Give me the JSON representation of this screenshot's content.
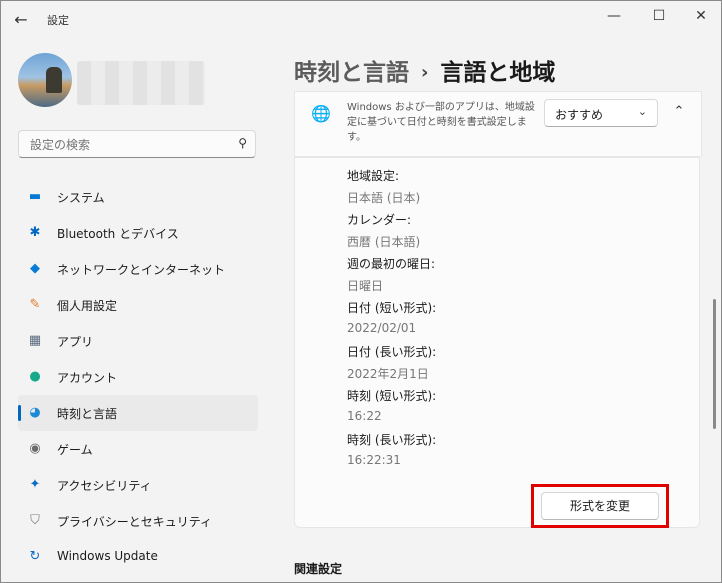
{
  "window": {
    "title": "設定"
  },
  "search": {
    "placeholder": "設定の検索"
  },
  "sidebar": {
    "items": [
      {
        "label": "システム",
        "icon": "monitor-icon",
        "color": "#0078d4"
      },
      {
        "label": "Bluetooth とデバイス",
        "icon": "bluetooth-icon",
        "color": "#0067c0"
      },
      {
        "label": "ネットワークとインターネット",
        "icon": "wifi-icon",
        "color": "#0a7bd6"
      },
      {
        "label": "個人用設定",
        "icon": "brush-icon",
        "color": "#e07b2c"
      },
      {
        "label": "アプリ",
        "icon": "apps-icon",
        "color": "#5a6b7d"
      },
      {
        "label": "アカウント",
        "icon": "person-icon",
        "color": "#18a88a"
      },
      {
        "label": "時刻と言語",
        "icon": "globe-clock-icon",
        "color": "#1d8ad8",
        "active": true
      },
      {
        "label": "ゲーム",
        "icon": "gamepad-icon",
        "color": "#6b6b6b"
      },
      {
        "label": "アクセシビリティ",
        "icon": "accessibility-icon",
        "color": "#0a6cc2"
      },
      {
        "label": "プライバシーとセキュリティ",
        "icon": "shield-icon",
        "color": "#7a7a7a"
      },
      {
        "label": "Windows Update",
        "icon": "update-icon",
        "color": "#0a6cc2"
      }
    ]
  },
  "breadcrumb": {
    "parent": "時刻と言語",
    "separator": "›",
    "current": "言語と地域"
  },
  "format_card": {
    "description": "Windows および一部のアプリは、地域設定に基づいて日付と時刻を書式設定します。",
    "dropdown_value": "おすすめ",
    "rows": [
      {
        "label": "地域設定:",
        "value": "日本語 (日本)"
      },
      {
        "label": "カレンダー:",
        "value": "西暦 (日本語)"
      },
      {
        "label": "週の最初の曜日:",
        "value": "日曜日"
      },
      {
        "label": "日付 (短い形式):",
        "value": "2022/02/01"
      },
      {
        "label": "日付 (長い形式):",
        "value": "2022年2月1日"
      },
      {
        "label": "時刻 (短い形式):",
        "value": "16:22"
      },
      {
        "label": "時刻 (長い形式):",
        "value": "16:22:31"
      }
    ],
    "change_button": "形式を変更"
  },
  "related": {
    "title": "関連設定"
  },
  "colors": {
    "accent": "#0067c0",
    "highlight": "#e00000"
  }
}
